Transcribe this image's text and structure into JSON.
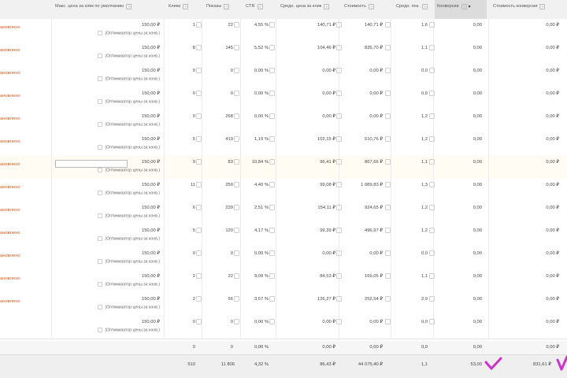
{
  "headers": [
    {
      "label": "Макс. цена за клик по умолчанию"
    },
    {
      "label": "Клики"
    },
    {
      "label": "Показы"
    },
    {
      "label": "CTR"
    },
    {
      "label": "Средн. цена за клик"
    },
    {
      "label": "Стоимость"
    },
    {
      "label": "Средн. поз."
    },
    {
      "label": "Конверсии"
    },
    {
      "label": "Стоимость конверсии"
    }
  ],
  "status_text": "ановлено",
  "rows": [
    {
      "bid": "150,00 ₽",
      "bid_note": "(Оптимизатор цены за конв.)",
      "clicks": "1",
      "impr": "22",
      "ctr": "4,55 %",
      "cpc": "140,71 ₽",
      "cost": "140,71 ₽",
      "pos": "1,6",
      "conv": "0,00",
      "cpconv": "0,00 ₽",
      "status": "ановлено"
    },
    {
      "bid": "150,00 ₽",
      "bid_note": "(Оптимизатор цены за конв.)",
      "clicks": "8",
      "impr": "145",
      "ctr": "5,52 %",
      "cpc": "104,46 ₽",
      "cost": "835,70 ₽",
      "pos": "1,1",
      "conv": "0,00",
      "cpconv": "0,00 ₽",
      "status": "ановлено"
    },
    {
      "bid": "150,00 ₽",
      "bid_note": "(Оптимизатор цены за конв.)",
      "clicks": "0",
      "impr": "0",
      "ctr": "0,00 %",
      "cpc": "0,00 ₽",
      "cost": "0,00 ₽",
      "pos": "0,0",
      "conv": "0,00",
      "cpconv": "0,00 ₽",
      "status": "ановлено"
    },
    {
      "bid": "150,00 ₽",
      "bid_note": "(Оптимизатор цены за конв.)",
      "clicks": "0",
      "impr": "0",
      "ctr": "0,00 %",
      "cpc": "0,00 ₽",
      "cost": "0,00 ₽",
      "pos": "0,0",
      "conv": "0,00",
      "cpconv": "0,00 ₽",
      "status": "ановлено"
    },
    {
      "bid": "150,00 ₽",
      "bid_note": "(Оптимизатор цены за конв.)",
      "clicks": "0",
      "impr": "268",
      "ctr": "0,00 %",
      "cpc": "0,00 ₽",
      "cost": "0,00 ₽",
      "pos": "1,2",
      "conv": "0,00",
      "cpconv": "0,00 ₽",
      "status": "ановлено"
    },
    {
      "bid": "150,00 ₽",
      "bid_note": "(Оптимизатор цены за конв.)",
      "clicks": "5",
      "impr": "419",
      "ctr": "1,19 %",
      "cpc": "102,15 ₽",
      "cost": "510,76 ₽",
      "pos": "1,2",
      "conv": "0,00",
      "cpconv": "0,00 ₽",
      "status": "ановлено"
    },
    {
      "bid": "150,00 ₽",
      "bid_note": "(Оптимизатор цены за конв.)",
      "clicks": "9",
      "impr": "83",
      "ctr": "10,84 %",
      "cpc": "96,41 ₽",
      "cost": "867,66 ₽",
      "pos": "1,1",
      "conv": "0,00",
      "cpconv": "0,00 ₽",
      "status": "ановлено",
      "highlight": true
    },
    {
      "bid": "150,00 ₽",
      "bid_note": "(Оптимизатор цены за конв.)",
      "clicks": "11",
      "impr": "250",
      "ctr": "4,40 %",
      "cpc": "99,08 ₽",
      "cost": "1 089,83 ₽",
      "pos": "1,3",
      "conv": "0,00",
      "cpconv": "0,00 ₽",
      "status": "ановлено"
    },
    {
      "bid": "150,00 ₽",
      "bid_note": "(Оптимизатор цены за конв.)",
      "clicks": "6",
      "impr": "239",
      "ctr": "2,51 %",
      "cpc": "154,11 ₽",
      "cost": "924,65 ₽",
      "pos": "1,2",
      "conv": "0,00",
      "cpconv": "0,00 ₽",
      "status": "ановлено"
    },
    {
      "bid": "150,00 ₽",
      "bid_note": "(Оптимизатор цены за конв.)",
      "clicks": "5",
      "impr": "120",
      "ctr": "4,17 %",
      "cpc": "99,39 ₽",
      "cost": "496,97 ₽",
      "pos": "1,2",
      "conv": "0,00",
      "cpconv": "0,00 ₽",
      "status": "ановлено"
    },
    {
      "bid": "150,00 ₽",
      "bid_note": "(Оптимизатор цены за конв.)",
      "clicks": "0",
      "impr": "0",
      "ctr": "0,00 %",
      "cpc": "0,00 ₽",
      "cost": "0,00 ₽",
      "pos": "0,0",
      "conv": "0,00",
      "cpconv": "0,00 ₽",
      "status": "ановлено"
    },
    {
      "bid": "150,00 ₽",
      "bid_note": "(Оптимизатор цены за конв.)",
      "clicks": "2",
      "impr": "22",
      "ctr": "9,09 %",
      "cpc": "84,53 ₽",
      "cost": "169,05 ₽",
      "pos": "1,1",
      "conv": "0,00",
      "cpconv": "0,00 ₽",
      "status": "ановлено"
    },
    {
      "bid": "150,00 ₽",
      "bid_note": "(Оптимизатор цены за конв.)",
      "clicks": "2",
      "impr": "56",
      "ctr": "3,57 %",
      "cpc": "126,27 ₽",
      "cost": "252,54 ₽",
      "pos": "2,9",
      "conv": "0,00",
      "cpconv": "0,00 ₽",
      "status": "ановлено"
    },
    {
      "bid": "150,00 ₽",
      "bid_note": "(Оптимизатор цены за конв.)",
      "clicks": "0",
      "impr": "0",
      "ctr": "0,00 %",
      "cpc": "0,00 ₽",
      "cost": "0,00 ₽",
      "pos": "0,0",
      "conv": "0,00",
      "cpconv": "0,00 ₽",
      "status": ""
    }
  ],
  "total_a": {
    "clicks": "0",
    "impr": "0",
    "ctr": "0,00 %",
    "cpc": "0,00 ₽",
    "cost": "0,00 ₽",
    "pos": "0,0",
    "conv": "0,00",
    "cpconv": "0,00 ₽"
  },
  "total_b": {
    "clicks": "510",
    "impr": "11 806",
    "ctr": "4,32 %",
    "cpc": "86,43 ₽",
    "cost": "44 075,40 ₽",
    "pos": "1,1",
    "conv": "53,00",
    "cpconv": "831,61 ₽"
  },
  "colors": {
    "status": "#d05a16",
    "annotation": "#cc33cc"
  }
}
